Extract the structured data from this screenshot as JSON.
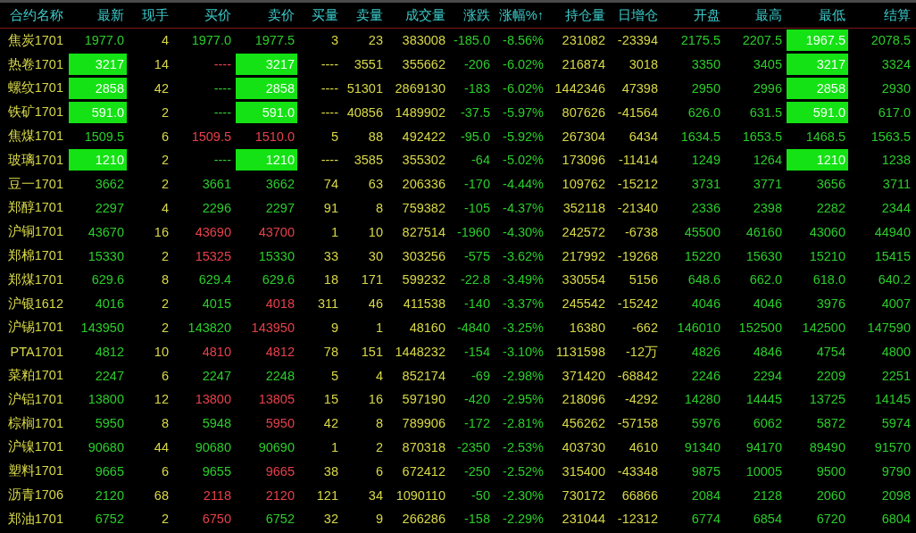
{
  "columns": [
    "合约名称",
    "最新",
    "现手",
    "买价",
    "卖价",
    "买量",
    "卖量",
    "成交量",
    "涨跌",
    "涨幅%↑",
    "持仓量",
    "日增仓",
    "开盘",
    "最高",
    "最低",
    "结算"
  ],
  "rows": [
    {
      "name": "焦炭1701",
      "cells": [
        {
          "text": "1977.0",
          "kind": "down"
        },
        {
          "text": "4",
          "kind": "flat"
        },
        {
          "text": "1977.0",
          "kind": "down"
        },
        {
          "text": "1977.5",
          "kind": "down"
        },
        {
          "text": "3",
          "kind": "flat"
        },
        {
          "text": "23",
          "kind": "flat"
        },
        {
          "text": "383008",
          "kind": "flat"
        },
        {
          "text": "-185.0",
          "kind": "down"
        },
        {
          "text": "-8.56%",
          "kind": "down"
        },
        {
          "text": "231082",
          "kind": "flat"
        },
        {
          "text": "-23394",
          "kind": "flat"
        },
        {
          "text": "2175.5",
          "kind": "down"
        },
        {
          "text": "2207.5",
          "kind": "down"
        },
        {
          "text": "1967.5",
          "kind": "limit"
        },
        {
          "text": "2078.5",
          "kind": "down"
        }
      ]
    },
    {
      "name": "热卷1701",
      "cells": [
        {
          "text": "3217",
          "kind": "limit"
        },
        {
          "text": "14",
          "kind": "flat"
        },
        {
          "text": "----",
          "kind": "up"
        },
        {
          "text": "3217",
          "kind": "limit"
        },
        {
          "text": "----",
          "kind": "flat"
        },
        {
          "text": "3551",
          "kind": "flat"
        },
        {
          "text": "355662",
          "kind": "flat"
        },
        {
          "text": "-206",
          "kind": "down"
        },
        {
          "text": "-6.02%",
          "kind": "down"
        },
        {
          "text": "216874",
          "kind": "flat"
        },
        {
          "text": "3018",
          "kind": "flat"
        },
        {
          "text": "3350",
          "kind": "down"
        },
        {
          "text": "3405",
          "kind": "down"
        },
        {
          "text": "3217",
          "kind": "limit"
        },
        {
          "text": "3324",
          "kind": "down"
        }
      ]
    },
    {
      "name": "螺纹1701",
      "cells": [
        {
          "text": "2858",
          "kind": "limit"
        },
        {
          "text": "42",
          "kind": "flat"
        },
        {
          "text": "----",
          "kind": "down"
        },
        {
          "text": "2858",
          "kind": "limit"
        },
        {
          "text": "----",
          "kind": "flat"
        },
        {
          "text": "51301",
          "kind": "flat"
        },
        {
          "text": "2869130",
          "kind": "flat"
        },
        {
          "text": "-183",
          "kind": "down"
        },
        {
          "text": "-6.02%",
          "kind": "down"
        },
        {
          "text": "1442346",
          "kind": "flat"
        },
        {
          "text": "47398",
          "kind": "flat"
        },
        {
          "text": "2950",
          "kind": "down"
        },
        {
          "text": "2996",
          "kind": "down"
        },
        {
          "text": "2858",
          "kind": "limit"
        },
        {
          "text": "2930",
          "kind": "down"
        }
      ]
    },
    {
      "name": "铁矿1701",
      "cells": [
        {
          "text": "591.0",
          "kind": "limit"
        },
        {
          "text": "2",
          "kind": "flat"
        },
        {
          "text": "----",
          "kind": "down"
        },
        {
          "text": "591.0",
          "kind": "limit"
        },
        {
          "text": "----",
          "kind": "flat"
        },
        {
          "text": "40856",
          "kind": "flat"
        },
        {
          "text": "1489902",
          "kind": "flat"
        },
        {
          "text": "-37.5",
          "kind": "down"
        },
        {
          "text": "-5.97%",
          "kind": "down"
        },
        {
          "text": "807626",
          "kind": "flat"
        },
        {
          "text": "-41564",
          "kind": "flat"
        },
        {
          "text": "626.0",
          "kind": "down"
        },
        {
          "text": "631.5",
          "kind": "down"
        },
        {
          "text": "591.0",
          "kind": "limit"
        },
        {
          "text": "617.0",
          "kind": "down"
        }
      ]
    },
    {
      "name": "焦煤1701",
      "cells": [
        {
          "text": "1509.5",
          "kind": "down"
        },
        {
          "text": "6",
          "kind": "flat"
        },
        {
          "text": "1509.5",
          "kind": "up"
        },
        {
          "text": "1510.0",
          "kind": "up"
        },
        {
          "text": "5",
          "kind": "flat"
        },
        {
          "text": "88",
          "kind": "flat"
        },
        {
          "text": "492422",
          "kind": "flat"
        },
        {
          "text": "-95.0",
          "kind": "down"
        },
        {
          "text": "-5.92%",
          "kind": "down"
        },
        {
          "text": "267304",
          "kind": "flat"
        },
        {
          "text": "6434",
          "kind": "flat"
        },
        {
          "text": "1634.5",
          "kind": "down"
        },
        {
          "text": "1653.5",
          "kind": "down"
        },
        {
          "text": "1468.5",
          "kind": "down"
        },
        {
          "text": "1563.5",
          "kind": "down"
        }
      ]
    },
    {
      "name": "玻璃1701",
      "cells": [
        {
          "text": "1210",
          "kind": "limit"
        },
        {
          "text": "2",
          "kind": "flat"
        },
        {
          "text": "----",
          "kind": "down"
        },
        {
          "text": "1210",
          "kind": "limit"
        },
        {
          "text": "----",
          "kind": "flat"
        },
        {
          "text": "3585",
          "kind": "flat"
        },
        {
          "text": "355302",
          "kind": "flat"
        },
        {
          "text": "-64",
          "kind": "down"
        },
        {
          "text": "-5.02%",
          "kind": "down"
        },
        {
          "text": "173096",
          "kind": "flat"
        },
        {
          "text": "-11414",
          "kind": "flat"
        },
        {
          "text": "1249",
          "kind": "down"
        },
        {
          "text": "1264",
          "kind": "down"
        },
        {
          "text": "1210",
          "kind": "limit"
        },
        {
          "text": "1238",
          "kind": "down"
        }
      ]
    },
    {
      "name": "豆一1701",
      "cells": [
        {
          "text": "3662",
          "kind": "down"
        },
        {
          "text": "2",
          "kind": "flat"
        },
        {
          "text": "3661",
          "kind": "down"
        },
        {
          "text": "3662",
          "kind": "down"
        },
        {
          "text": "74",
          "kind": "flat"
        },
        {
          "text": "63",
          "kind": "flat"
        },
        {
          "text": "206336",
          "kind": "flat"
        },
        {
          "text": "-170",
          "kind": "down"
        },
        {
          "text": "-4.44%",
          "kind": "down"
        },
        {
          "text": "109762",
          "kind": "flat"
        },
        {
          "text": "-15212",
          "kind": "flat"
        },
        {
          "text": "3731",
          "kind": "down"
        },
        {
          "text": "3771",
          "kind": "down"
        },
        {
          "text": "3656",
          "kind": "down"
        },
        {
          "text": "3711",
          "kind": "down"
        }
      ]
    },
    {
      "name": "郑醇1701",
      "cells": [
        {
          "text": "2297",
          "kind": "down"
        },
        {
          "text": "4",
          "kind": "flat"
        },
        {
          "text": "2296",
          "kind": "down"
        },
        {
          "text": "2297",
          "kind": "down"
        },
        {
          "text": "91",
          "kind": "flat"
        },
        {
          "text": "8",
          "kind": "flat"
        },
        {
          "text": "759382",
          "kind": "flat"
        },
        {
          "text": "-105",
          "kind": "down"
        },
        {
          "text": "-4.37%",
          "kind": "down"
        },
        {
          "text": "352118",
          "kind": "flat"
        },
        {
          "text": "-21340",
          "kind": "flat"
        },
        {
          "text": "2336",
          "kind": "down"
        },
        {
          "text": "2398",
          "kind": "down"
        },
        {
          "text": "2282",
          "kind": "down"
        },
        {
          "text": "2344",
          "kind": "down"
        }
      ]
    },
    {
      "name": "沪铜1701",
      "cells": [
        {
          "text": "43670",
          "kind": "down"
        },
        {
          "text": "16",
          "kind": "flat"
        },
        {
          "text": "43690",
          "kind": "up"
        },
        {
          "text": "43700",
          "kind": "up"
        },
        {
          "text": "1",
          "kind": "flat"
        },
        {
          "text": "10",
          "kind": "flat"
        },
        {
          "text": "827514",
          "kind": "flat"
        },
        {
          "text": "-1960",
          "kind": "down"
        },
        {
          "text": "-4.30%",
          "kind": "down"
        },
        {
          "text": "242572",
          "kind": "flat"
        },
        {
          "text": "-6738",
          "kind": "flat"
        },
        {
          "text": "45500",
          "kind": "down"
        },
        {
          "text": "46160",
          "kind": "down"
        },
        {
          "text": "43060",
          "kind": "down"
        },
        {
          "text": "44940",
          "kind": "down"
        }
      ]
    },
    {
      "name": "郑棉1701",
      "cells": [
        {
          "text": "15330",
          "kind": "down"
        },
        {
          "text": "2",
          "kind": "flat"
        },
        {
          "text": "15325",
          "kind": "up"
        },
        {
          "text": "15330",
          "kind": "down"
        },
        {
          "text": "33",
          "kind": "flat"
        },
        {
          "text": "30",
          "kind": "flat"
        },
        {
          "text": "303256",
          "kind": "flat"
        },
        {
          "text": "-575",
          "kind": "down"
        },
        {
          "text": "-3.62%",
          "kind": "down"
        },
        {
          "text": "217992",
          "kind": "flat"
        },
        {
          "text": "-19268",
          "kind": "flat"
        },
        {
          "text": "15220",
          "kind": "down"
        },
        {
          "text": "15630",
          "kind": "down"
        },
        {
          "text": "15210",
          "kind": "down"
        },
        {
          "text": "15415",
          "kind": "down"
        }
      ]
    },
    {
      "name": "郑煤1701",
      "cells": [
        {
          "text": "629.6",
          "kind": "down"
        },
        {
          "text": "8",
          "kind": "flat"
        },
        {
          "text": "629.4",
          "kind": "down"
        },
        {
          "text": "629.6",
          "kind": "down"
        },
        {
          "text": "18",
          "kind": "flat"
        },
        {
          "text": "171",
          "kind": "flat"
        },
        {
          "text": "599232",
          "kind": "flat"
        },
        {
          "text": "-22.8",
          "kind": "down"
        },
        {
          "text": "-3.49%",
          "kind": "down"
        },
        {
          "text": "330554",
          "kind": "flat"
        },
        {
          "text": "5156",
          "kind": "flat"
        },
        {
          "text": "648.6",
          "kind": "down"
        },
        {
          "text": "662.0",
          "kind": "down"
        },
        {
          "text": "618.0",
          "kind": "down"
        },
        {
          "text": "640.2",
          "kind": "down"
        }
      ]
    },
    {
      "name": "沪银1612",
      "cells": [
        {
          "text": "4016",
          "kind": "down"
        },
        {
          "text": "2",
          "kind": "flat"
        },
        {
          "text": "4015",
          "kind": "down"
        },
        {
          "text": "4018",
          "kind": "up"
        },
        {
          "text": "311",
          "kind": "flat"
        },
        {
          "text": "46",
          "kind": "flat"
        },
        {
          "text": "411538",
          "kind": "flat"
        },
        {
          "text": "-140",
          "kind": "down"
        },
        {
          "text": "-3.37%",
          "kind": "down"
        },
        {
          "text": "245542",
          "kind": "flat"
        },
        {
          "text": "-15242",
          "kind": "flat"
        },
        {
          "text": "4046",
          "kind": "down"
        },
        {
          "text": "4046",
          "kind": "down"
        },
        {
          "text": "3976",
          "kind": "down"
        },
        {
          "text": "4007",
          "kind": "down"
        }
      ]
    },
    {
      "name": "沪锡1701",
      "cells": [
        {
          "text": "143950",
          "kind": "down"
        },
        {
          "text": "2",
          "kind": "flat"
        },
        {
          "text": "143820",
          "kind": "down"
        },
        {
          "text": "143950",
          "kind": "up"
        },
        {
          "text": "9",
          "kind": "flat"
        },
        {
          "text": "1",
          "kind": "flat"
        },
        {
          "text": "48160",
          "kind": "flat"
        },
        {
          "text": "-4840",
          "kind": "down"
        },
        {
          "text": "-3.25%",
          "kind": "down"
        },
        {
          "text": "16380",
          "kind": "flat"
        },
        {
          "text": "-662",
          "kind": "flat"
        },
        {
          "text": "146010",
          "kind": "down"
        },
        {
          "text": "152500",
          "kind": "down"
        },
        {
          "text": "142500",
          "kind": "down"
        },
        {
          "text": "147590",
          "kind": "down"
        }
      ]
    },
    {
      "name": "PTA1701",
      "cells": [
        {
          "text": "4812",
          "kind": "down"
        },
        {
          "text": "10",
          "kind": "flat"
        },
        {
          "text": "4810",
          "kind": "up"
        },
        {
          "text": "4812",
          "kind": "up"
        },
        {
          "text": "78",
          "kind": "flat"
        },
        {
          "text": "151",
          "kind": "flat"
        },
        {
          "text": "1448232",
          "kind": "flat"
        },
        {
          "text": "-154",
          "kind": "down"
        },
        {
          "text": "-3.10%",
          "kind": "down"
        },
        {
          "text": "1131598",
          "kind": "flat"
        },
        {
          "text": "-12万",
          "kind": "flat"
        },
        {
          "text": "4826",
          "kind": "down"
        },
        {
          "text": "4846",
          "kind": "down"
        },
        {
          "text": "4754",
          "kind": "down"
        },
        {
          "text": "4800",
          "kind": "down"
        }
      ]
    },
    {
      "name": "菜粕1701",
      "cells": [
        {
          "text": "2247",
          "kind": "down"
        },
        {
          "text": "6",
          "kind": "flat"
        },
        {
          "text": "2247",
          "kind": "down"
        },
        {
          "text": "2248",
          "kind": "down"
        },
        {
          "text": "5",
          "kind": "flat"
        },
        {
          "text": "4",
          "kind": "flat"
        },
        {
          "text": "852174",
          "kind": "flat"
        },
        {
          "text": "-69",
          "kind": "down"
        },
        {
          "text": "-2.98%",
          "kind": "down"
        },
        {
          "text": "371420",
          "kind": "flat"
        },
        {
          "text": "-68842",
          "kind": "flat"
        },
        {
          "text": "2246",
          "kind": "down"
        },
        {
          "text": "2294",
          "kind": "down"
        },
        {
          "text": "2209",
          "kind": "down"
        },
        {
          "text": "2251",
          "kind": "down"
        }
      ]
    },
    {
      "name": "沪铝1701",
      "cells": [
        {
          "text": "13800",
          "kind": "down"
        },
        {
          "text": "12",
          "kind": "flat"
        },
        {
          "text": "13800",
          "kind": "up"
        },
        {
          "text": "13805",
          "kind": "up"
        },
        {
          "text": "15",
          "kind": "flat"
        },
        {
          "text": "16",
          "kind": "flat"
        },
        {
          "text": "597190",
          "kind": "flat"
        },
        {
          "text": "-420",
          "kind": "down"
        },
        {
          "text": "-2.95%",
          "kind": "down"
        },
        {
          "text": "218096",
          "kind": "flat"
        },
        {
          "text": "-4292",
          "kind": "flat"
        },
        {
          "text": "14280",
          "kind": "down"
        },
        {
          "text": "14445",
          "kind": "down"
        },
        {
          "text": "13725",
          "kind": "down"
        },
        {
          "text": "14145",
          "kind": "down"
        }
      ]
    },
    {
      "name": "棕榈1701",
      "cells": [
        {
          "text": "5950",
          "kind": "down"
        },
        {
          "text": "8",
          "kind": "flat"
        },
        {
          "text": "5948",
          "kind": "down"
        },
        {
          "text": "5950",
          "kind": "up"
        },
        {
          "text": "42",
          "kind": "flat"
        },
        {
          "text": "8",
          "kind": "flat"
        },
        {
          "text": "789906",
          "kind": "flat"
        },
        {
          "text": "-172",
          "kind": "down"
        },
        {
          "text": "-2.81%",
          "kind": "down"
        },
        {
          "text": "456262",
          "kind": "flat"
        },
        {
          "text": "-57158",
          "kind": "flat"
        },
        {
          "text": "5976",
          "kind": "down"
        },
        {
          "text": "6062",
          "kind": "down"
        },
        {
          "text": "5872",
          "kind": "down"
        },
        {
          "text": "5974",
          "kind": "down"
        }
      ]
    },
    {
      "name": "沪镍1701",
      "cells": [
        {
          "text": "90680",
          "kind": "down"
        },
        {
          "text": "44",
          "kind": "flat"
        },
        {
          "text": "90680",
          "kind": "down"
        },
        {
          "text": "90690",
          "kind": "down"
        },
        {
          "text": "1",
          "kind": "flat"
        },
        {
          "text": "2",
          "kind": "flat"
        },
        {
          "text": "870318",
          "kind": "flat"
        },
        {
          "text": "-2350",
          "kind": "down"
        },
        {
          "text": "-2.53%",
          "kind": "down"
        },
        {
          "text": "403730",
          "kind": "flat"
        },
        {
          "text": "4610",
          "kind": "flat"
        },
        {
          "text": "91340",
          "kind": "down"
        },
        {
          "text": "94170",
          "kind": "down"
        },
        {
          "text": "89490",
          "kind": "down"
        },
        {
          "text": "91570",
          "kind": "down"
        }
      ]
    },
    {
      "name": "塑料1701",
      "cells": [
        {
          "text": "9665",
          "kind": "down"
        },
        {
          "text": "6",
          "kind": "flat"
        },
        {
          "text": "9655",
          "kind": "down"
        },
        {
          "text": "9665",
          "kind": "up"
        },
        {
          "text": "38",
          "kind": "flat"
        },
        {
          "text": "6",
          "kind": "flat"
        },
        {
          "text": "672412",
          "kind": "flat"
        },
        {
          "text": "-250",
          "kind": "down"
        },
        {
          "text": "-2.52%",
          "kind": "down"
        },
        {
          "text": "315400",
          "kind": "flat"
        },
        {
          "text": "-43348",
          "kind": "flat"
        },
        {
          "text": "9875",
          "kind": "down"
        },
        {
          "text": "10005",
          "kind": "down"
        },
        {
          "text": "9500",
          "kind": "down"
        },
        {
          "text": "9790",
          "kind": "down"
        }
      ]
    },
    {
      "name": "沥青1706",
      "cells": [
        {
          "text": "2120",
          "kind": "down"
        },
        {
          "text": "68",
          "kind": "flat"
        },
        {
          "text": "2118",
          "kind": "up"
        },
        {
          "text": "2120",
          "kind": "up"
        },
        {
          "text": "121",
          "kind": "flat"
        },
        {
          "text": "34",
          "kind": "flat"
        },
        {
          "text": "1090110",
          "kind": "flat"
        },
        {
          "text": "-50",
          "kind": "down"
        },
        {
          "text": "-2.30%",
          "kind": "down"
        },
        {
          "text": "730172",
          "kind": "flat"
        },
        {
          "text": "66866",
          "kind": "flat"
        },
        {
          "text": "2084",
          "kind": "down"
        },
        {
          "text": "2128",
          "kind": "down"
        },
        {
          "text": "2060",
          "kind": "down"
        },
        {
          "text": "2098",
          "kind": "down"
        }
      ]
    },
    {
      "name": "郑油1701",
      "cells": [
        {
          "text": "6752",
          "kind": "down"
        },
        {
          "text": "2",
          "kind": "flat"
        },
        {
          "text": "6750",
          "kind": "up"
        },
        {
          "text": "6752",
          "kind": "down"
        },
        {
          "text": "32",
          "kind": "flat"
        },
        {
          "text": "9",
          "kind": "flat"
        },
        {
          "text": "266286",
          "kind": "flat"
        },
        {
          "text": "-158",
          "kind": "down"
        },
        {
          "text": "-2.29%",
          "kind": "down"
        },
        {
          "text": "231044",
          "kind": "flat"
        },
        {
          "text": "-12312",
          "kind": "flat"
        },
        {
          "text": "6774",
          "kind": "down"
        },
        {
          "text": "6854",
          "kind": "down"
        },
        {
          "text": "6720",
          "kind": "down"
        },
        {
          "text": "6804",
          "kind": "down"
        }
      ]
    }
  ]
}
